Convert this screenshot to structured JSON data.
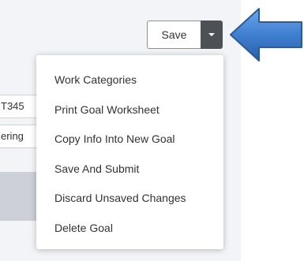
{
  "toolbar": {
    "save_label": "Save",
    "caret_icon": "chevron-down-icon"
  },
  "background_fields": [
    {
      "value": "T345"
    },
    {
      "value": "ering"
    }
  ],
  "dropdown_menu": {
    "items": [
      {
        "label": "Work Categories"
      },
      {
        "label": "Print Goal Worksheet"
      },
      {
        "label": "Copy Info Into New Goal"
      },
      {
        "label": "Save And Submit"
      },
      {
        "label": "Discard Unsaved Changes"
      },
      {
        "label": "Delete Goal"
      }
    ]
  },
  "annotation": {
    "arrow_icon": "pointer-arrow-icon",
    "arrow_color": "#3f7fd0"
  },
  "colors": {
    "page_background": "#f2f4f7",
    "caret_button": "#4d5156",
    "menu_background": "#ffffff",
    "text": "#333333"
  }
}
